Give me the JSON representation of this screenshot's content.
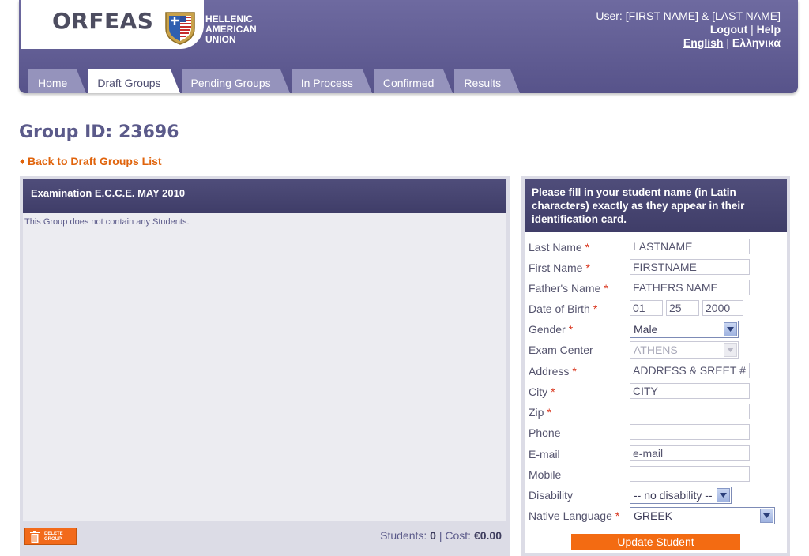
{
  "header": {
    "logo": "ORFEAS",
    "union_line1": "HELLENIC",
    "union_line2": "AMERICAN",
    "union_line3": "UNION",
    "user_text": "User: [FIRST NAME] & [LAST NAME]",
    "logout": "Logout",
    "separator": "|",
    "help": "Help",
    "lang_en": "English",
    "lang_el": "Ελληνικά"
  },
  "tabs": [
    {
      "label": "Home",
      "active": false
    },
    {
      "label": "Draft Groups",
      "active": true
    },
    {
      "label": "Pending Groups",
      "active": false
    },
    {
      "label": "In Process",
      "active": false
    },
    {
      "label": "Confirmed",
      "active": false
    },
    {
      "label": "Results",
      "active": false
    }
  ],
  "page": {
    "title": "Group ID: 23696",
    "back_link": "Back to Draft Groups List"
  },
  "left_panel": {
    "header": "Examination E.C.C.E. MAY 2010",
    "empty_message": "This Group does not contain any Students.",
    "delete_button_line1": "DELETE",
    "delete_button_line2": "GROUP",
    "students_label": "Students:",
    "students_count": "0",
    "cost_label": "Cost:",
    "cost_value": "€0.00"
  },
  "right_panel": {
    "header": "Please fill in your student name (in Latin characters) exactly as they appear in their identification card.",
    "required_mark": "*",
    "fields": {
      "last_name": {
        "label": "Last Name",
        "value": "LASTNAME"
      },
      "first_name": {
        "label": "First Name",
        "value": "FIRSTNAME"
      },
      "fathers_name": {
        "label": "Father's Name",
        "value": "FATHERS NAME"
      },
      "dob": {
        "label": "Date of Birth",
        "month": "01",
        "day": "25",
        "year": "2000"
      },
      "gender": {
        "label": "Gender",
        "value": "Male"
      },
      "exam_center": {
        "label": "Exam Center",
        "value": "ATHENS"
      },
      "address": {
        "label": "Address",
        "value": "ADDRESS & SREET #"
      },
      "city": {
        "label": "City",
        "value": "CITY"
      },
      "zip": {
        "label": "Zip",
        "value": ""
      },
      "phone": {
        "label": "Phone",
        "value": ""
      },
      "email": {
        "label": "E-mail",
        "value": "e-mail"
      },
      "mobile": {
        "label": "Mobile",
        "value": ""
      },
      "disability": {
        "label": "Disability",
        "value": "-- no disability --"
      },
      "native_language": {
        "label": "Native Language",
        "value": "GREEK"
      }
    },
    "update_button": "Update Student"
  },
  "colors": {
    "header_bg": "#6e6aa0",
    "accent_orange": "#f36b12",
    "title_color": "#5b5a8a",
    "required_red": "#d9341c"
  }
}
